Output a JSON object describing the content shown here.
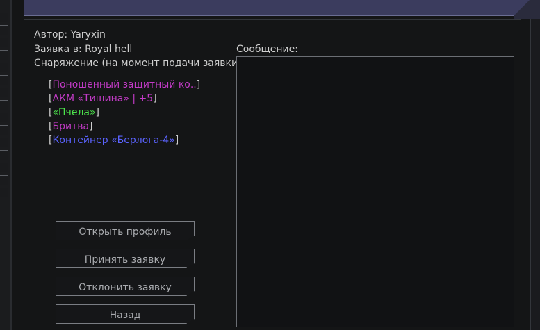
{
  "application": {
    "author_line": "Автор: Yaryxin",
    "target_line": "Заявка в: Royal hell",
    "equipment_heading": "Снаряжение (на момент подачи заявки):",
    "equipment": [
      {
        "name": "Поношенный защитный ко..",
        "color": "#c33bc7"
      },
      {
        "name": "АКМ «Тишина» | +5",
        "color": "#c33bc7"
      },
      {
        "name": "«Пчела»",
        "color": "#4ce54c"
      },
      {
        "name": "Бритва",
        "color": "#c33bc7"
      },
      {
        "name": "Контейнер «Берлога-4»",
        "color": "#5b63ff"
      }
    ]
  },
  "message": {
    "label": "Сообщение:",
    "text": ""
  },
  "buttons": {
    "open_profile": "Открыть профиль",
    "accept": "Принять заявку",
    "decline": "Отклонить заявку",
    "back": "Назад"
  },
  "colors": {
    "header": "#3b3c5e",
    "background": "#141516",
    "border": "#7a7d83"
  }
}
